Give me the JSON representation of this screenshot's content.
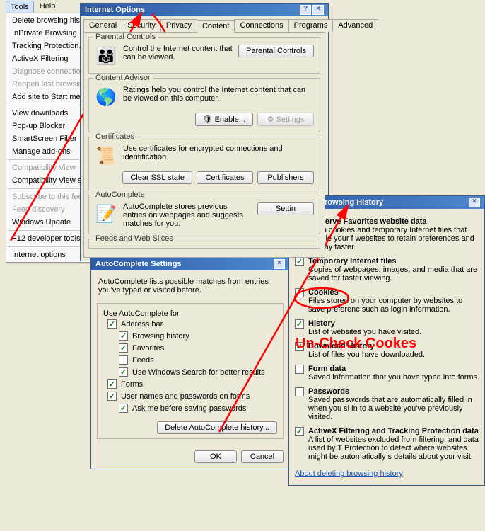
{
  "menu_bar": {
    "tools": "Tools",
    "help": "Help"
  },
  "tools_menu": {
    "items": [
      {
        "label": "Delete browsing histo",
        "dis": false
      },
      {
        "label": "InPrivate Browsing",
        "dis": false
      },
      {
        "label": "Tracking Protection.",
        "dis": false
      },
      {
        "label": "ActiveX Filtering",
        "dis": false
      },
      {
        "label": "Diagnose connection",
        "dis": true
      },
      {
        "label": "Reopen last browsini",
        "dis": true
      },
      {
        "label": "Add site to Start men",
        "dis": false
      },
      {
        "label": "-"
      },
      {
        "label": "View downloads",
        "dis": false
      },
      {
        "label": "Pop-up Blocker",
        "dis": false
      },
      {
        "label": "SmartScreen Filter",
        "dis": false
      },
      {
        "label": "Manage add-ons",
        "dis": false
      },
      {
        "label": "-"
      },
      {
        "label": "Compatibility View",
        "dis": true
      },
      {
        "label": "Compatibility View se",
        "dis": false
      },
      {
        "label": "-"
      },
      {
        "label": "Subscribe to this feed",
        "dis": true
      },
      {
        "label": "Feed discovery",
        "dis": true
      },
      {
        "label": "Windows Update",
        "dis": false
      },
      {
        "label": "-"
      },
      {
        "label": "F12 developer tools",
        "dis": false
      },
      {
        "label": "-"
      },
      {
        "label": "Internet options",
        "dis": false
      }
    ]
  },
  "io": {
    "title": "Internet Options",
    "tabs": [
      "General",
      "Security",
      "Privacy",
      "Content",
      "Connections",
      "Programs",
      "Advanced"
    ],
    "active_tab": "Content",
    "parental": {
      "legend": "Parental Controls",
      "desc": "Control the Internet content that can be viewed.",
      "btn": "Parental Controls"
    },
    "advisor": {
      "legend": "Content Advisor",
      "desc": "Ratings help you control the Internet content that can be viewed on this computer.",
      "enable": "Enable...",
      "settings": "Settings"
    },
    "certs": {
      "legend": "Certificates",
      "desc": "Use certificates for encrypted connections and identification.",
      "clear": "Clear SSL state",
      "cert": "Certificates",
      "pub": "Publishers"
    },
    "autocomplete": {
      "legend": "AutoComplete",
      "desc": "AutoComplete stores previous entries on webpages and suggests matches for you.",
      "btn": "Settin"
    },
    "feeds": {
      "legend": "Feeds and Web Slices"
    }
  },
  "ac": {
    "title": "AutoComplete Settings",
    "intro": "AutoComplete lists possible matches from entries you've typed or visited before.",
    "group": "Use AutoComplete for",
    "items": [
      {
        "label": "Address bar",
        "checked": true,
        "indent": 0
      },
      {
        "label": "Browsing history",
        "checked": true,
        "indent": 1
      },
      {
        "label": "Favorites",
        "checked": true,
        "indent": 1
      },
      {
        "label": "Feeds",
        "checked": false,
        "indent": 1
      },
      {
        "label": "Use Windows Search for better results",
        "checked": true,
        "indent": 1
      },
      {
        "label": "Forms",
        "checked": true,
        "indent": 0
      },
      {
        "label": "User names and passwords on forms",
        "checked": true,
        "indent": 0
      },
      {
        "label": "Ask me before saving passwords",
        "checked": true,
        "indent": 1
      }
    ],
    "del_btn": "Delete AutoComplete history...",
    "ok": "OK",
    "cancel": "Cancel"
  },
  "dbh": {
    "title": "Delete Browsing History",
    "items": [
      {
        "checked": true,
        "label": "Preserve Favorites website data",
        "exp": "Keep cookies and temporary Internet files that enable your f websites to retain preferences and display faster."
      },
      {
        "checked": true,
        "label": "Temporary Internet files",
        "exp": "Copies of webpages, images, and media that are saved for faster viewing."
      },
      {
        "checked": false,
        "label": "Cookies",
        "exp": "Files stored on your computer by websites to save preferenc such as login information."
      },
      {
        "checked": true,
        "label": "History",
        "exp": "List of websites you have visited."
      },
      {
        "checked": true,
        "label": "Download History",
        "exp": "List of files you have downloaded."
      },
      {
        "checked": false,
        "label": "Form data",
        "exp": "Saved information that you have typed into forms."
      },
      {
        "checked": false,
        "label": "Passwords",
        "exp": "Saved passwords that are automatically filled in when you si in to a website you've previously visited."
      },
      {
        "checked": true,
        "label": "ActiveX Filtering and Tracking Protection data",
        "exp": "A list of websites excluded from filtering, and data used by T Protection to detect where websites might be automatically s details about your visit."
      }
    ],
    "link": "About deleting browsing history"
  },
  "annotation": "Un-Check Cookes"
}
